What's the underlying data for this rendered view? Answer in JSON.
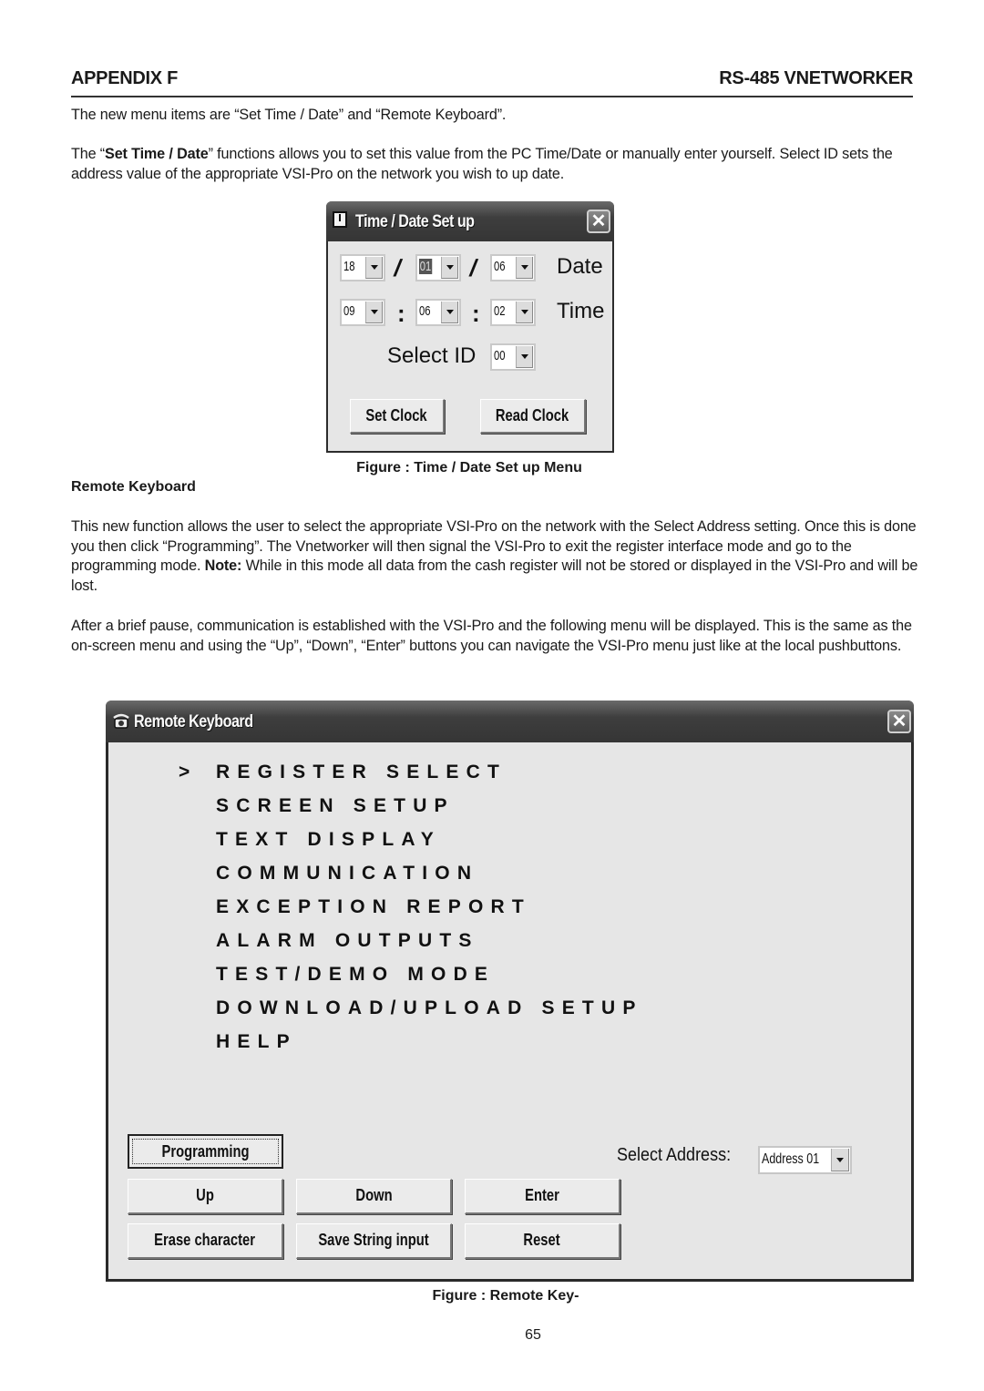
{
  "header": {
    "left": "APPENDIX F",
    "right": "RS-485 VNETWORKER"
  },
  "paragraphs": {
    "p1": "The new menu items are “Set Time / Date” and “Remote Keyboard”.",
    "p2_pre": "The “",
    "p2_bold": "Set Time / Date",
    "p2_post": "” functions allows you to set this value from the PC Time/Date or manually enter yourself. Select ID sets the address value of the appropriate VSI-Pro on the network you wish to up date.",
    "p3_pre": "This new function allows the user to select the appropriate VSI-Pro on the network with the Select Address setting. Once this is done you then click “Programming”. The Vnetworker will then signal the VSI-Pro to exit the register interface mode and go to the programming mode. ",
    "p3_bold": "Note:",
    "p3_post": " While in this mode all data from the cash register will not be stored or displayed in the VSI-Pro and will be lost.",
    "p4": "After a brief pause, communication is established with the VSI-Pro and the following menu will be displayed. This is the same as the on-screen menu and using the “Up”, “Down”, “Enter”  buttons you can navigate the VSI-Pro menu just like at the local pushbuttons."
  },
  "captions": {
    "time_date": "Figure : Time / Date Set up Menu",
    "remote_keyboard_heading": "Remote Keyboard",
    "remote_key": "Figure : Remote Key-"
  },
  "page_number": "65",
  "time_date_window": {
    "title": "Time / Date Set up",
    "close_icon": "close-icon",
    "date": {
      "day": "18",
      "month": "01",
      "year": "06",
      "separator": "/",
      "label": "Date"
    },
    "time": {
      "hour": "09",
      "minute": "06",
      "second": "02",
      "separator": ":",
      "label": "Time"
    },
    "select_id": {
      "label": "Select ID",
      "value": "00"
    },
    "buttons": {
      "set_clock": "Set Clock",
      "read_clock": "Read Clock"
    }
  },
  "remote_keyboard_window": {
    "title": "Remote Keyboard",
    "cursor": ">",
    "menu_items": [
      "REGISTER SELECT",
      "SCREEN SETUP",
      "TEXT DISPLAY",
      "COMMUNICATION",
      "EXCEPTION REPORT",
      "ALARM OUTPUTS",
      "TEST/DEMO MODE",
      "DOWNLOAD/UPLOAD SETUP",
      "HELP"
    ],
    "selected_index": 0,
    "select_address": {
      "label": "Select Address:",
      "value": "Address 01"
    },
    "buttons": {
      "programming": "Programming",
      "up": "Up",
      "down": "Down",
      "enter": "Enter",
      "erase_character": "Erase character",
      "save_string_input": "Save String input",
      "reset": "Reset"
    }
  }
}
